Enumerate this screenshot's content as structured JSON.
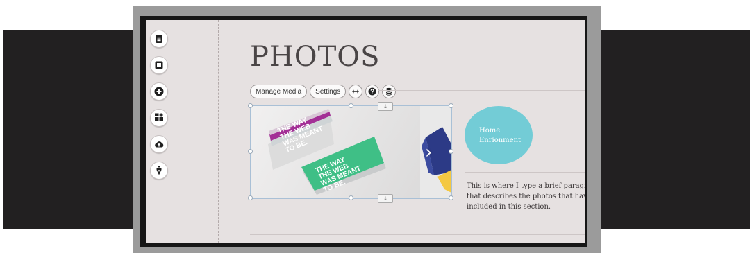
{
  "page": {
    "title": "PHOTOS",
    "toolbar": {
      "manage_media_label": "Manage Media",
      "settings_label": "Settings",
      "icons": [
        "resize-arrows-icon",
        "help-icon",
        "database-icon"
      ]
    },
    "left_tools": [
      {
        "name": "page-icon"
      },
      {
        "name": "square-icon"
      },
      {
        "name": "add-icon"
      },
      {
        "name": "widgets-icon"
      },
      {
        "name": "upload-cloud-icon"
      },
      {
        "name": "pen-icon"
      }
    ],
    "slider": {
      "card_text": [
        "THE WAY",
        "THE WEB",
        "WAS MEANT",
        "TO BE."
      ],
      "next_arrow": "›"
    },
    "circle": {
      "line1": "Home",
      "line2": "Enrionment"
    },
    "paragraph": {
      "line1": "This is where I type a brief paragraph",
      "line2": "that describes the photos that have been",
      "line3": "included in this section."
    }
  },
  "colors": {
    "canvas_bg": "#e6e1e1",
    "circle": "#73ccd6",
    "card_magenta": "#a32f96",
    "card_green": "#3fbf86",
    "card_navy": "#2c3a86",
    "card_yellow": "#f4c842"
  }
}
